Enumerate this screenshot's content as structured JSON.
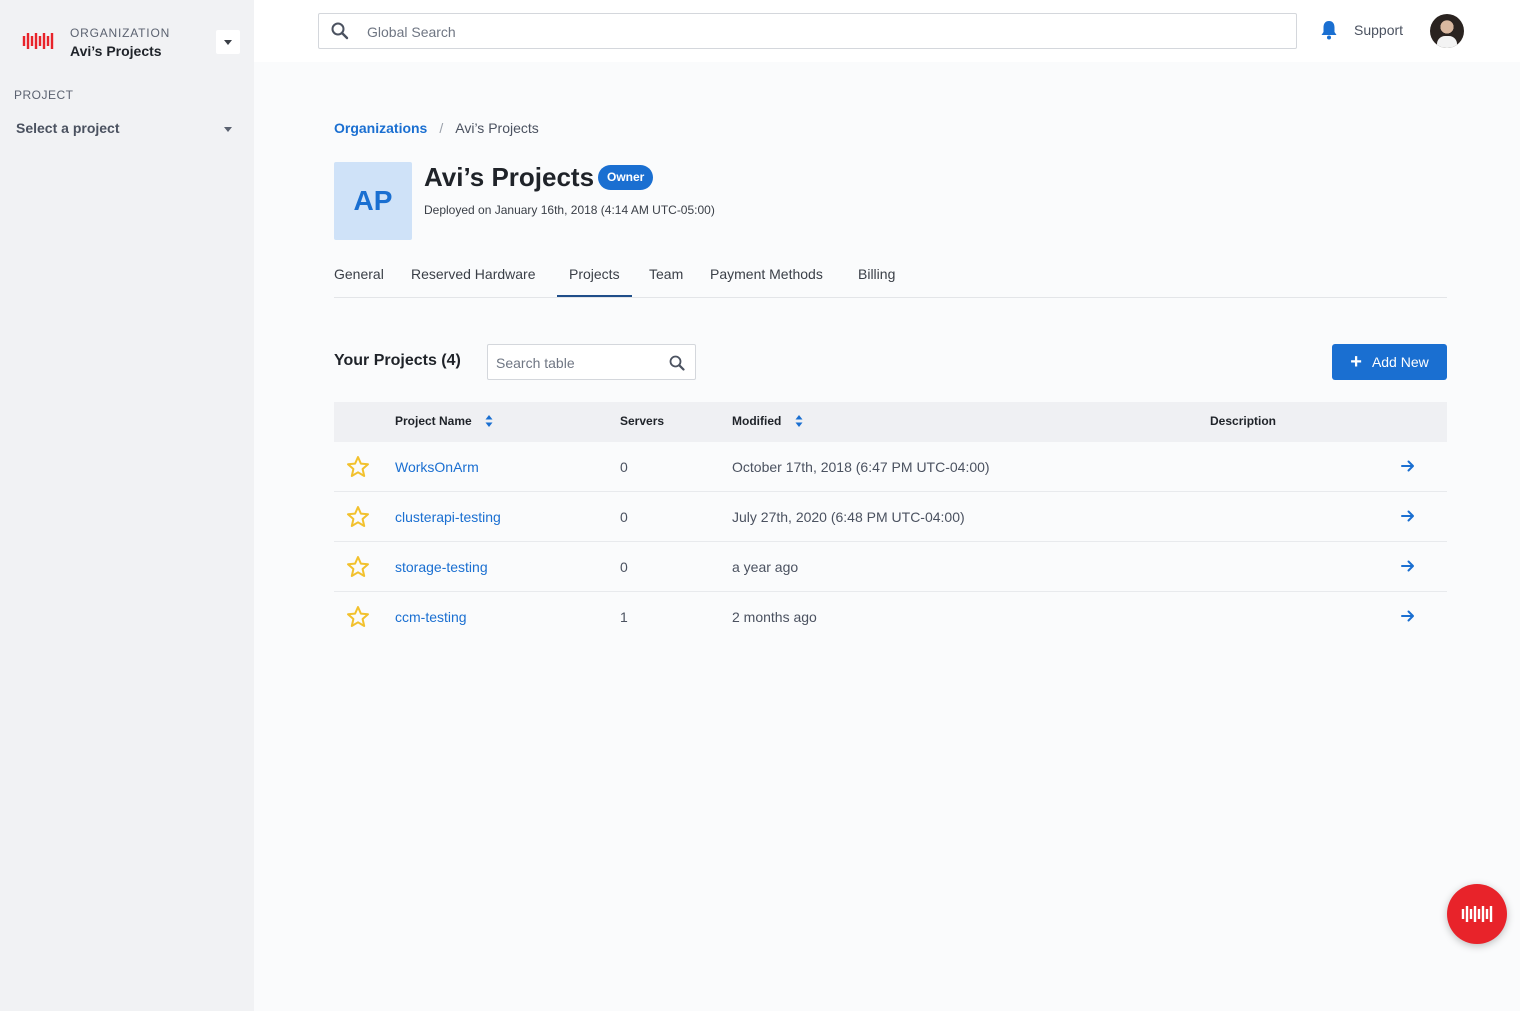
{
  "sidebar": {
    "org_label": "ORGANIZATION",
    "org_name": "Avi’s Projects",
    "project_label": "PROJECT",
    "project_select": "Select a project"
  },
  "topbar": {
    "search_placeholder": "Global Search",
    "support": "Support"
  },
  "breadcrumb": {
    "link": "Organizations",
    "separator": "/",
    "current": "Avi’s Projects"
  },
  "org": {
    "initials": "AP",
    "name": "Avi’s Projects",
    "badge": "Owner",
    "deployed": "Deployed on January 16th, 2018 (4:14 AM UTC-05:00)"
  },
  "tabs": [
    "General",
    "Reserved Hardware",
    "Projects",
    "Team",
    "Payment Methods",
    "Billing"
  ],
  "projects": {
    "title": "Your Projects (4)",
    "search_placeholder": "Search table",
    "add_new": "Add New",
    "columns": [
      "Project Name",
      "Servers",
      "Modified",
      "Description"
    ],
    "rows": [
      {
        "name": "WorksOnArm",
        "servers": "0",
        "modified": "October 17th, 2018 (6:47 PM UTC-04:00)",
        "description": ""
      },
      {
        "name": "clusterapi-testing",
        "servers": "0",
        "modified": "July 27th, 2020 (6:48 PM UTC-04:00)",
        "description": ""
      },
      {
        "name": "storage-testing",
        "servers": "0",
        "modified": "a year ago",
        "description": ""
      },
      {
        "name": "ccm-testing",
        "servers": "1",
        "modified": "2 months ago",
        "description": ""
      }
    ]
  },
  "colors": {
    "accent": "#1a6fd1",
    "brand_red": "#e8232a",
    "star": "#f2c12e"
  }
}
